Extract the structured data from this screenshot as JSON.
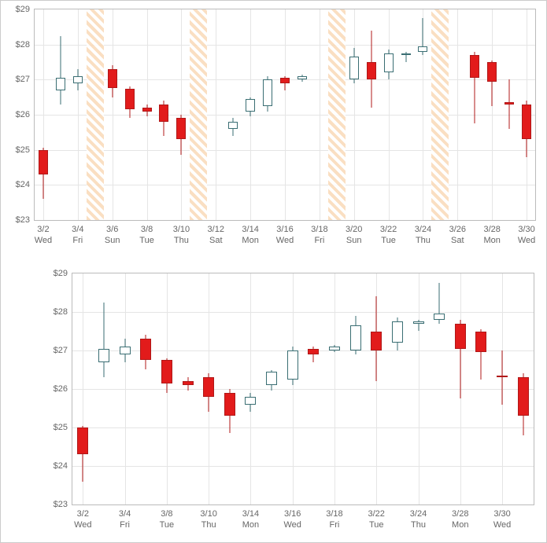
{
  "chart_data": [
    {
      "type": "candlestick",
      "ylabel": "",
      "xlabel": "",
      "ylim": [
        23,
        29
      ],
      "yticks": [
        23,
        24,
        25,
        26,
        27,
        28,
        29
      ],
      "yprefix": "$",
      "xticks": [
        "3/2\nWed",
        "3/4\nFri",
        "3/6\nSun",
        "3/8\nTue",
        "3/10\nThu",
        "3/12\nSat",
        "3/14\nMon",
        "3/16\nWed",
        "3/18\nFri",
        "3/20\nSun",
        "3/22\nTue",
        "3/24\nThu",
        "3/26\nSat",
        "3/28\nMon",
        "3/30\nWed"
      ],
      "hatch_zones": [
        [
          3,
          4
        ],
        [
          9,
          10
        ],
        [
          17,
          18
        ],
        [
          23,
          24
        ]
      ],
      "series": [
        {
          "name": "price",
          "data": [
            {
              "i": 0,
              "date": "3/2",
              "open": 25.0,
              "high": 25.05,
              "low": 23.6,
              "close": 24.3
            },
            {
              "i": 1,
              "date": "3/3",
              "open": 26.7,
              "high": 28.25,
              "low": 26.3,
              "close": 27.05
            },
            {
              "i": 2,
              "date": "3/4",
              "open": 26.9,
              "high": 27.3,
              "low": 26.7,
              "close": 27.1
            },
            {
              "i": 4,
              "date": "3/7",
              "open": 27.3,
              "high": 27.4,
              "low": 26.5,
              "close": 26.75
            },
            {
              "i": 5,
              "date": "3/8",
              "open": 26.75,
              "high": 26.8,
              "low": 25.9,
              "close": 26.15
            },
            {
              "i": 6,
              "date": "3/9",
              "open": 26.2,
              "high": 26.3,
              "low": 25.95,
              "close": 26.1
            },
            {
              "i": 7,
              "date": "3/10",
              "open": 26.3,
              "high": 26.4,
              "low": 25.4,
              "close": 25.8
            },
            {
              "i": 8,
              "date": "3/11",
              "open": 25.9,
              "high": 26.0,
              "low": 24.85,
              "close": 25.3
            },
            {
              "i": 11,
              "date": "3/14",
              "open": 25.6,
              "high": 25.9,
              "low": 25.4,
              "close": 25.8
            },
            {
              "i": 12,
              "date": "3/15",
              "open": 26.1,
              "high": 26.5,
              "low": 25.95,
              "close": 26.45
            },
            {
              "i": 13,
              "date": "3/16",
              "open": 26.25,
              "high": 27.1,
              "low": 26.1,
              "close": 27.0
            },
            {
              "i": 14,
              "date": "3/17",
              "open": 27.05,
              "high": 27.1,
              "low": 26.7,
              "close": 26.9
            },
            {
              "i": 15,
              "date": "3/18",
              "open": 27.0,
              "high": 27.15,
              "low": 26.95,
              "close": 27.1
            },
            {
              "i": 18,
              "date": "3/21",
              "open": 27.0,
              "high": 27.9,
              "low": 26.9,
              "close": 27.65
            },
            {
              "i": 19,
              "date": "3/22",
              "open": 27.5,
              "high": 28.4,
              "low": 26.2,
              "close": 27.0
            },
            {
              "i": 20,
              "date": "3/23",
              "open": 27.2,
              "high": 27.85,
              "low": 27.0,
              "close": 27.75
            },
            {
              "i": 21,
              "date": "3/24",
              "open": 27.7,
              "high": 27.8,
              "low": 27.5,
              "close": 27.75
            },
            {
              "i": 22,
              "date": "3/25",
              "open": 27.8,
              "high": 28.75,
              "low": 27.7,
              "close": 27.95
            },
            {
              "i": 25,
              "date": "3/28",
              "open": 27.7,
              "high": 27.8,
              "low": 25.75,
              "close": 27.05
            },
            {
              "i": 26,
              "date": "3/29",
              "open": 27.5,
              "high": 27.55,
              "low": 26.25,
              "close": 26.95
            },
            {
              "i": 27,
              "date": "3/30",
              "open": 26.35,
              "high": 27.0,
              "low": 25.6,
              "close": 26.3
            },
            {
              "i": 28,
              "date": "3/31",
              "open": 26.3,
              "high": 26.4,
              "low": 24.8,
              "close": 25.3
            }
          ]
        }
      ],
      "n_slots": 29
    },
    {
      "type": "candlestick",
      "ylabel": "",
      "xlabel": "",
      "ylim": [
        23,
        29
      ],
      "yticks": [
        23,
        24,
        25,
        26,
        27,
        28,
        29
      ],
      "yprefix": "$",
      "xticks": [
        "3/2\nWed",
        "3/4\nFri",
        "3/8\nTue",
        "3/10\nThu",
        "3/14\nMon",
        "3/16\nWed",
        "3/18\nFri",
        "3/22\nTue",
        "3/24\nThu",
        "3/28\nMon",
        "3/30\nWed"
      ],
      "series": [
        {
          "name": "price",
          "data": [
            {
              "i": 0,
              "date": "3/2",
              "open": 25.0,
              "high": 25.05,
              "low": 23.6,
              "close": 24.3
            },
            {
              "i": 1,
              "date": "3/3",
              "open": 26.7,
              "high": 28.25,
              "low": 26.3,
              "close": 27.05
            },
            {
              "i": 2,
              "date": "3/4",
              "open": 26.9,
              "high": 27.3,
              "low": 26.7,
              "close": 27.1
            },
            {
              "i": 3,
              "date": "3/7",
              "open": 27.3,
              "high": 27.4,
              "low": 26.5,
              "close": 26.75
            },
            {
              "i": 4,
              "date": "3/8",
              "open": 26.75,
              "high": 26.8,
              "low": 25.9,
              "close": 26.15
            },
            {
              "i": 5,
              "date": "3/9",
              "open": 26.2,
              "high": 26.3,
              "low": 25.95,
              "close": 26.1
            },
            {
              "i": 6,
              "date": "3/10",
              "open": 26.3,
              "high": 26.4,
              "low": 25.4,
              "close": 25.8
            },
            {
              "i": 7,
              "date": "3/11",
              "open": 25.9,
              "high": 26.0,
              "low": 24.85,
              "close": 25.3
            },
            {
              "i": 8,
              "date": "3/14",
              "open": 25.6,
              "high": 25.9,
              "low": 25.4,
              "close": 25.8
            },
            {
              "i": 9,
              "date": "3/15",
              "open": 26.1,
              "high": 26.5,
              "low": 25.95,
              "close": 26.45
            },
            {
              "i": 10,
              "date": "3/16",
              "open": 26.25,
              "high": 27.1,
              "low": 26.1,
              "close": 27.0
            },
            {
              "i": 11,
              "date": "3/17",
              "open": 27.05,
              "high": 27.1,
              "low": 26.7,
              "close": 26.9
            },
            {
              "i": 12,
              "date": "3/18",
              "open": 27.0,
              "high": 27.15,
              "low": 26.95,
              "close": 27.1
            },
            {
              "i": 13,
              "date": "3/21",
              "open": 27.0,
              "high": 27.9,
              "low": 26.9,
              "close": 27.65
            },
            {
              "i": 14,
              "date": "3/22",
              "open": 27.5,
              "high": 28.4,
              "low": 26.2,
              "close": 27.0
            },
            {
              "i": 15,
              "date": "3/23",
              "open": 27.2,
              "high": 27.85,
              "low": 27.0,
              "close": 27.75
            },
            {
              "i": 16,
              "date": "3/24",
              "open": 27.7,
              "high": 27.8,
              "low": 27.5,
              "close": 27.75
            },
            {
              "i": 17,
              "date": "3/25",
              "open": 27.8,
              "high": 28.75,
              "low": 27.7,
              "close": 27.95
            },
            {
              "i": 18,
              "date": "3/28",
              "open": 27.7,
              "high": 27.8,
              "low": 25.75,
              "close": 27.05
            },
            {
              "i": 19,
              "date": "3/29",
              "open": 27.5,
              "high": 27.55,
              "low": 26.25,
              "close": 26.95
            },
            {
              "i": 20,
              "date": "3/30",
              "open": 26.35,
              "high": 27.0,
              "low": 25.6,
              "close": 26.3
            },
            {
              "i": 21,
              "date": "3/31",
              "open": 26.3,
              "high": 26.4,
              "low": 24.8,
              "close": 25.3
            }
          ]
        }
      ],
      "n_slots": 22
    }
  ]
}
